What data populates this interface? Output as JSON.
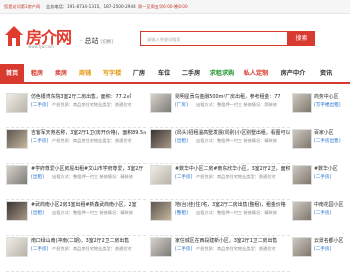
{
  "topbar": {
    "welcome": "您是访问第1房产网",
    "hotline": "业务电话：191-8734-1315、187-2500-2944",
    "hours": "周一至周五早6:00-晚8:00"
  },
  "header": {
    "brand": "房介网",
    "domain": "www.fjw.com",
    "station": "总站",
    "station_sub": "[切换]",
    "search_placeholder": "请输入关键词搜索",
    "search_button": "搜索"
  },
  "nav": [
    {
      "label": "首页",
      "style": "active"
    },
    {
      "label": "租房",
      "style": "red"
    },
    {
      "label": "卖房",
      "style": "red"
    },
    {
      "label": "商铺",
      "style": "gold"
    },
    {
      "label": "写字楼",
      "style": "gold"
    },
    {
      "label": "厂房",
      "style": ""
    },
    {
      "label": "车位",
      "style": ""
    },
    {
      "label": "二手房",
      "style": ""
    },
    {
      "label": "求租求购",
      "style": "green"
    },
    {
      "label": "私人定制",
      "style": "red"
    },
    {
      "label": "房产中介",
      "style": ""
    },
    {
      "label": "资讯",
      "style": ""
    }
  ],
  "col1": [
    {
      "title": "仿色银湾东院3室2厅二房出售，面积：77.2㎡",
      "tag": "[二手房]",
      "desc": "产权性质：商品房住宅物业类型：普通住宅"
    },
    {
      "title": "吉客军天苑名称，3室2厅1卫(房开价格)，面积89.5㎡",
      "tag": "[二手房]",
      "desc": "产权性质：商品房住宅物业类型：普通住宅"
    },
    {
      "title": "#学府尊爱小区房屋出租#文山市学府尊爱，3室2厅",
      "tag": "[出租]",
      "desc": "出租方式：整租押一付三 装修情况：精装修"
    },
    {
      "title": "#武商南小区2房3室出租#新鑫武商南小区，2室",
      "tag": "[出租]",
      "desc": "出租方式：整租押一付三 装修情况：精装修"
    },
    {
      "title": "南口绿山南(冲南(二期)，3室2厅2卫二房出售",
      "tag": "[二手房]",
      "desc": "产权性质：商品房住宅物业类型：普通住宅"
    }
  ],
  "col2": [
    {
      "title": "昆明星贡鸟金融500m²厂房出租，参考租金：77",
      "tag": "[厂房]",
      "desc": "出租方式：整租押一付三 装修情况：简装修"
    },
    {
      "title": "(局头)招租温高墅发展(局别)小区别墅出租，看图可以",
      "tag": "[出租]",
      "desc": "出租方式：整租押一付三 装修情况：精装修"
    },
    {
      "title": "#数华中小区二房#南东欣华小区，3室2厅2卫，面积",
      "tag": "[二手房]",
      "desc": "产权性质：商品房住宅物业类型：普通住宅"
    },
    {
      "title": "地(台)佳(住)宅，3室2厅二房出售(整租)，租金价格",
      "tag": "[整租]",
      "desc": "出租方式：整租押一付三 装修情况：精装修"
    },
    {
      "title": "家住城区在西段建新小区，3室2厅1卫二房出售",
      "tag": "[二手房]",
      "desc": "产权性质：商品房住宅物业类型：普通住宅"
    }
  ],
  "col3": [
    {
      "title": "商务中心区",
      "tag": "[写字楼出租]"
    },
    {
      "title": "百家小区",
      "tag": "[二手房出售]"
    },
    {
      "title": "#数华小区",
      "tag": "[二手房]"
    },
    {
      "title": "中南花园小区",
      "tag": "[二手房]"
    },
    {
      "title": "云景名都小区",
      "tag": "[二手房]"
    }
  ]
}
